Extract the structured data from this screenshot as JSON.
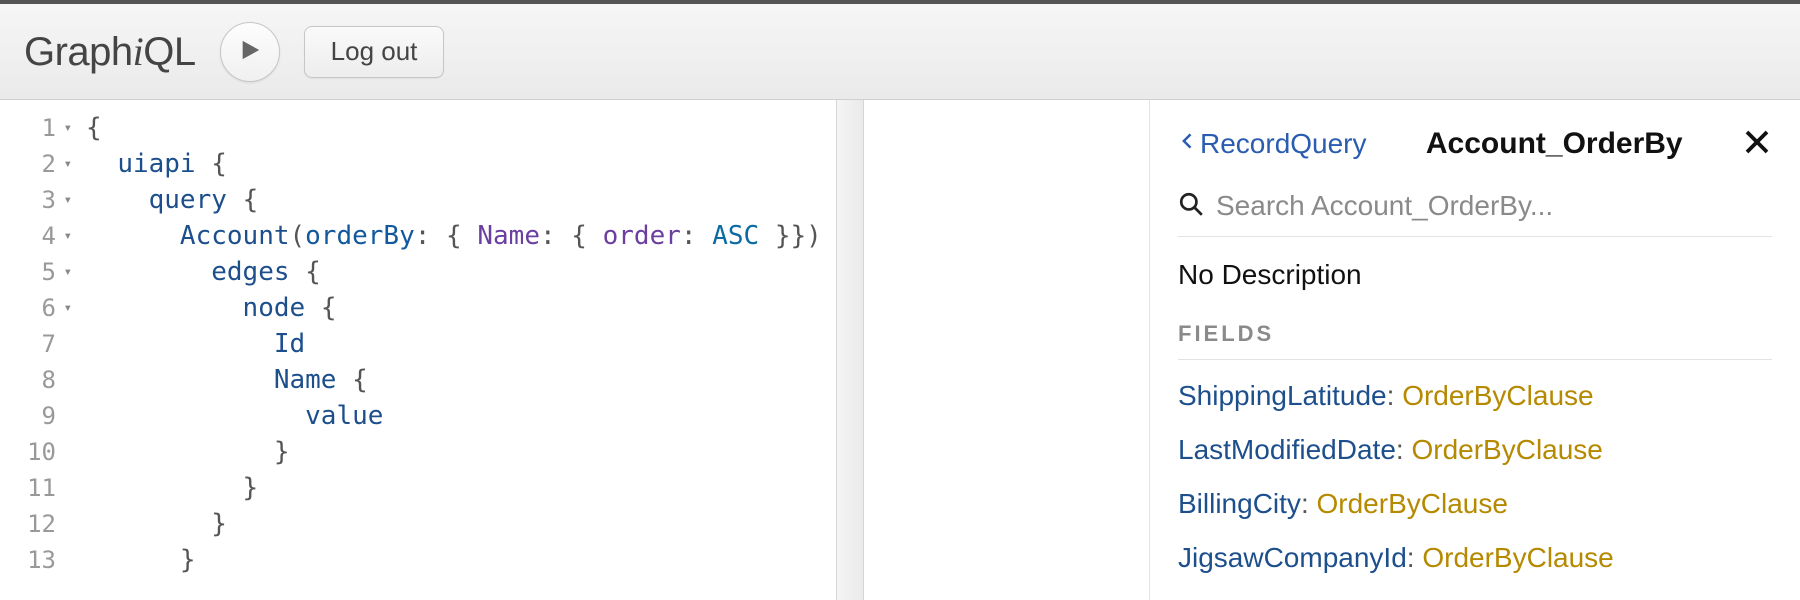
{
  "app": {
    "name_prefix": "Graph",
    "name_i": "i",
    "name_suffix": "QL"
  },
  "toolbar": {
    "logout_label": "Log out"
  },
  "editor": {
    "lines": [
      {
        "n": "1",
        "fold": true,
        "html": "<span class='tok-punct'>{</span>"
      },
      {
        "n": "2",
        "fold": true,
        "html": "  <span class='tok-field'>uiapi</span> <span class='tok-punct'>{</span>"
      },
      {
        "n": "3",
        "fold": true,
        "html": "    <span class='tok-field'>query</span> <span class='tok-punct'>{</span>"
      },
      {
        "n": "4",
        "fold": true,
        "html": "      <span class='tok-field'>Account</span><span class='tok-punct'>(</span><span class='tok-arg'>orderBy</span><span class='tok-punct'>: {</span> <span class='tok-key'>Name</span><span class='tok-punct'>: {</span> <span class='tok-key'>order</span><span class='tok-punct'>:</span> <span class='tok-enum'>ASC</span> <span class='tok-punct'>}})</span>"
      },
      {
        "n": "5",
        "fold": true,
        "html": "        <span class='tok-field'>edges</span> <span class='tok-punct'>{</span>"
      },
      {
        "n": "6",
        "fold": true,
        "html": "          <span class='tok-field'>node</span> <span class='tok-punct'>{</span>"
      },
      {
        "n": "7",
        "fold": false,
        "html": "            <span class='tok-field'>Id</span>"
      },
      {
        "n": "8",
        "fold": false,
        "html": "            <span class='tok-field'>Name</span> <span class='tok-punct'>{</span>"
      },
      {
        "n": "9",
        "fold": false,
        "html": "              <span class='tok-field'>value</span>"
      },
      {
        "n": "10",
        "fold": false,
        "html": "            <span class='tok-punct'>}</span>"
      },
      {
        "n": "11",
        "fold": false,
        "html": "          <span class='tok-punct'>}</span>"
      },
      {
        "n": "12",
        "fold": false,
        "html": "        <span class='tok-punct'>}</span>"
      },
      {
        "n": "13",
        "fold": false,
        "html": "      <span class='tok-punct'>}</span>"
      }
    ]
  },
  "docs": {
    "back_label": "RecordQuery",
    "title": "Account_OrderBy",
    "search_placeholder": "Search Account_OrderBy...",
    "no_description": "No Description",
    "fields_section": "FIELDS",
    "fields": [
      {
        "name": "ShippingLatitude",
        "type": "OrderByClause"
      },
      {
        "name": "LastModifiedDate",
        "type": "OrderByClause"
      },
      {
        "name": "BillingCity",
        "type": "OrderByClause"
      },
      {
        "name": "JigsawCompanyId",
        "type": "OrderByClause"
      }
    ]
  }
}
